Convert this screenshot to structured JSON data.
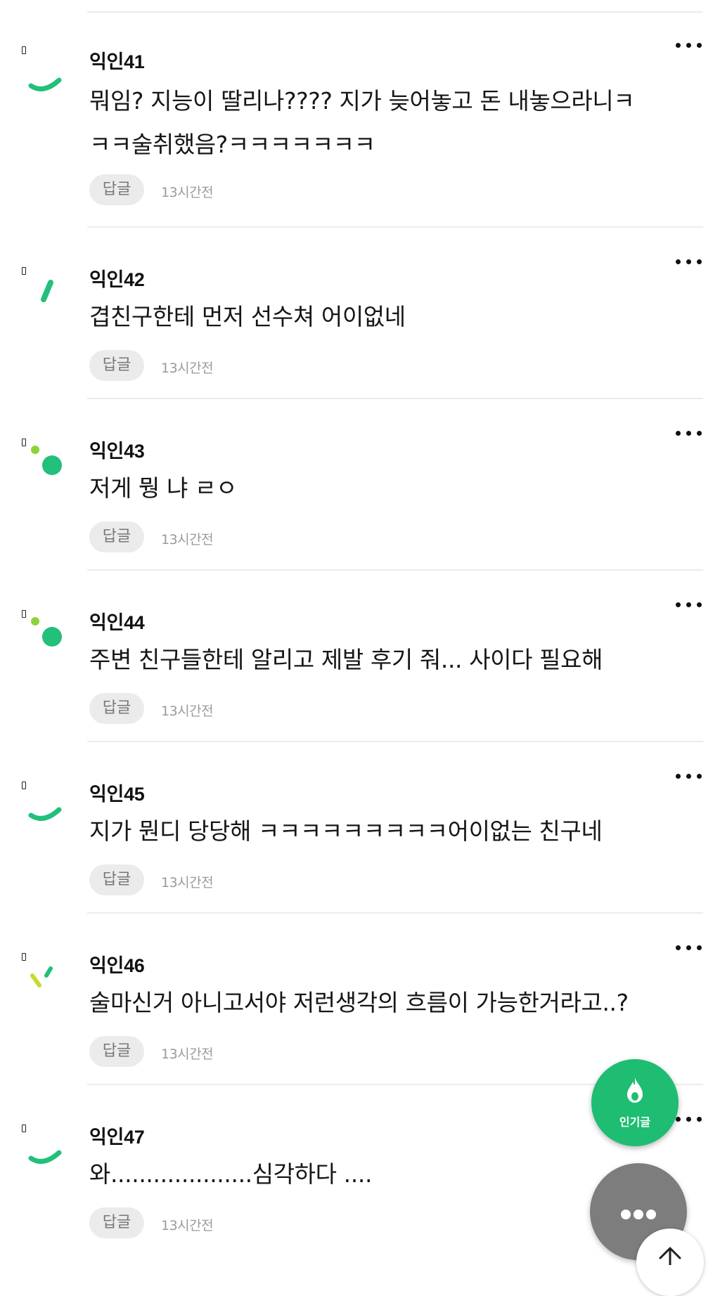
{
  "colors": {
    "accent_green": "#1ebd72",
    "avatar_green": "#22c07a",
    "avatar_lime": "#8dd43a",
    "divider": "#ececec",
    "menu_gray": "#7d7d7d"
  },
  "comments": [
    {
      "author": "익인41",
      "text": "뭐임? 지능이 딸리나???? 지가 늦어놓고 돈 내놓으라니ㅋ\nㅋㅋ술취했음?ㅋㅋㅋㅋㅋㅋㅋ",
      "reply_label": "답글",
      "time": "13시간전",
      "avatar_icon": "green-arc-icon"
    },
    {
      "author": "익인42",
      "text": "겹친구한테 먼저 선수쳐 어이없네",
      "reply_label": "답글",
      "time": "13시간전",
      "avatar_icon": "green-slash-icon"
    },
    {
      "author": "익인43",
      "text": "저게 뭥 냐 ㄹㅇ",
      "reply_label": "답글",
      "time": "13시간전",
      "avatar_icon": "green-dots-icon"
    },
    {
      "author": "익인44",
      "text": "주변 친구들한테 알리고 제발 후기 줘... 사이다 필요해",
      "reply_label": "답글",
      "time": "13시간전",
      "avatar_icon": "green-dots-icon"
    },
    {
      "author": "익인45",
      "text": "지가 뭔디 당당해 ㅋㅋㅋㅋㅋㅋㅋㅋㅋ어이없는 친구네",
      "reply_label": "답글",
      "time": "13시간전",
      "avatar_icon": "green-arc-icon"
    },
    {
      "author": "익인46",
      "text": "술마신거 아니고서야 저런생각의 흐름이 가능한거라고..?",
      "reply_label": "답글",
      "time": "13시간전",
      "avatar_icon": "lime-marks-icon"
    },
    {
      "author": "익인47",
      "text": "와....................심각하다 ....",
      "reply_label": "답글",
      "time": "13시간전",
      "avatar_icon": "green-arc-icon"
    }
  ],
  "fab": {
    "popular_label": "인기글",
    "popular_icon": "flame-icon",
    "menu_icon": "more-dots-icon",
    "top_icon": "arrow-up-icon"
  }
}
